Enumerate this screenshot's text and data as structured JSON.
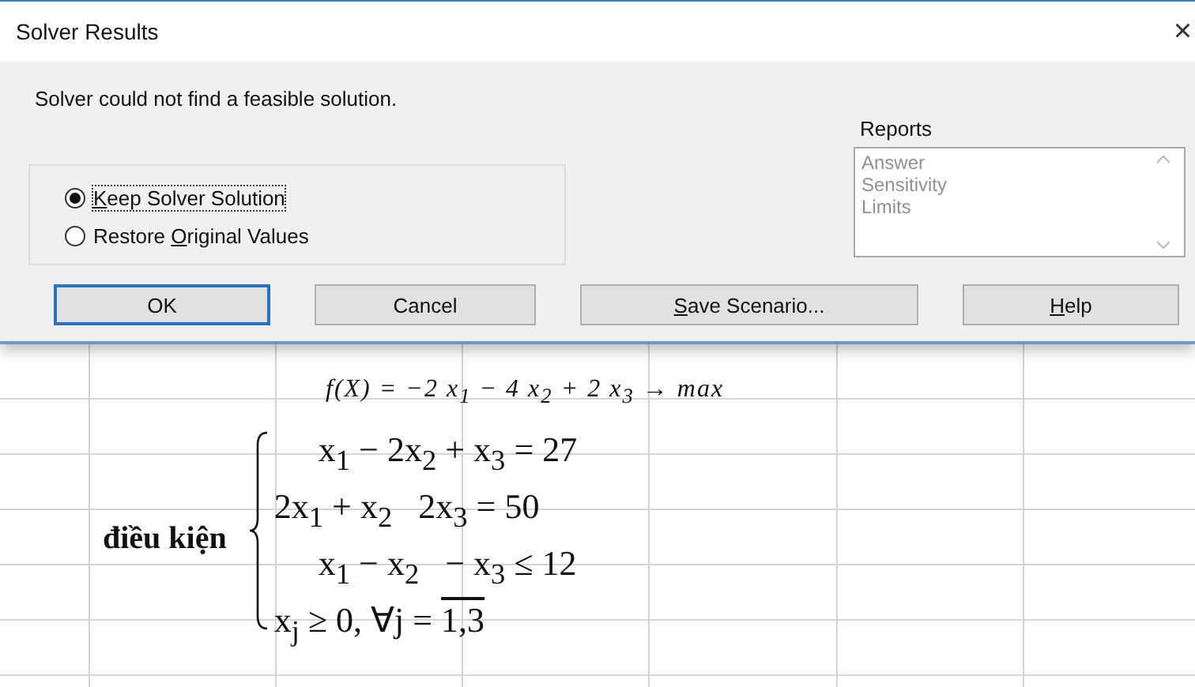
{
  "window": {
    "title": "Solver Results",
    "close": "×"
  },
  "message": "Solver could not find a feasible solution.",
  "options": [
    {
      "key": "K",
      "after": "eep Solver Solution",
      "selected": true
    },
    {
      "before": "Restore ",
      "key": "O",
      "after": "riginal Values",
      "selected": false
    }
  ],
  "reports": {
    "label": "Reports",
    "disabled": true,
    "items": [
      "Answer",
      "Sensitivity",
      "Limits"
    ]
  },
  "buttons": [
    {
      "after": "OK",
      "default": true
    },
    {
      "after": "Cancel",
      "default": false
    },
    {
      "key": "S",
      "after": "ave Scenario...",
      "default": false
    },
    {
      "key": "H",
      "after": "elp",
      "default": false
    }
  ],
  "sheet": {
    "objective": "f(X) = −2 x$_{1}$ − 4 x$_{2}$ + 2 x$_{3}$ → max",
    "condition_label": "điều kiện",
    "constraints": [
      "x$_{1}$ − 2x$_{2}$ + x$_{3}$ = 27",
      "2x$_{1}$ + x$_{2}$   2x$_{3}$ = 50",
      "x$_{1}$ − x$_{2}$   − x$_{3}$ ≤ 12"
    ],
    "domain": {
      "text": "x$_{j}$ ≥ 0, ∀j = ",
      "range": "1,3"
    }
  }
}
